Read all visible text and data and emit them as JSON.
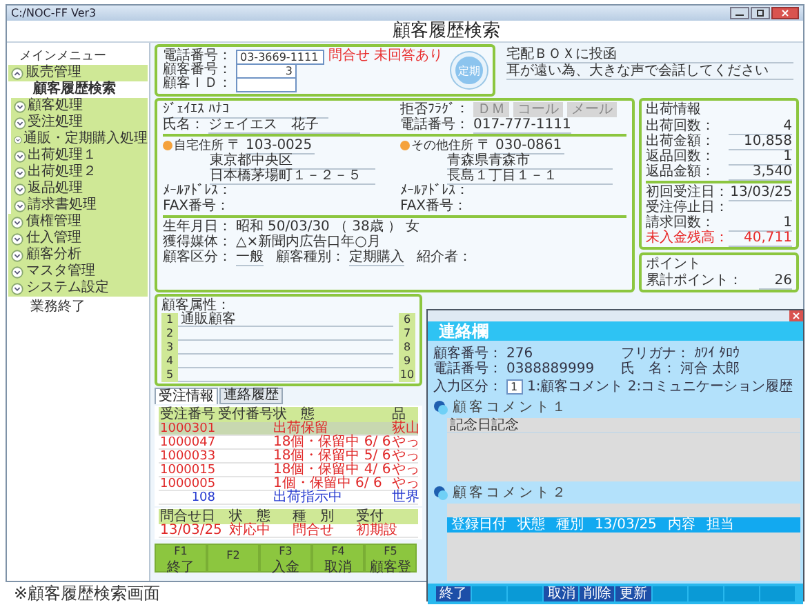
{
  "window": {
    "title": "C:/NOC-FF Ver3"
  },
  "header": {
    "title": "顧客履歴検索"
  },
  "sidebar": {
    "title": "メインメニュー",
    "groups": [
      {
        "label": "販売管理",
        "expanded": true,
        "children": [
          {
            "label": "顧客履歴検索",
            "kind": "page",
            "selected": true
          },
          {
            "label": "顧客処理",
            "kind": "folder",
            "selected": false
          },
          {
            "label": "受注処理",
            "kind": "folder",
            "selected": false
          },
          {
            "label": "通販・定期購入処理",
            "kind": "folder",
            "selected": false
          },
          {
            "label": "出荷処理１",
            "kind": "folder",
            "selected": false
          },
          {
            "label": "出荷処理２",
            "kind": "folder",
            "selected": false
          },
          {
            "label": "返品処理",
            "kind": "folder",
            "selected": false
          },
          {
            "label": "請求書処理",
            "kind": "folder",
            "selected": false
          }
        ]
      },
      {
        "label": "債権管理",
        "expanded": false
      },
      {
        "label": "仕入管理",
        "expanded": false
      },
      {
        "label": "顧客分析",
        "expanded": false
      },
      {
        "label": "マスタ管理",
        "expanded": false
      },
      {
        "label": "システム設定",
        "expanded": false
      }
    ],
    "footer": "業務終了"
  },
  "search": {
    "fields": [
      {
        "label": "電話番号：",
        "value": "03-3669-1111"
      },
      {
        "label": "顧客番号：",
        "value": "3"
      },
      {
        "label": "顧客ＩＤ："
      }
    ],
    "alerts": [
      "問合せ",
      "未回答あり"
    ],
    "refresh": "定期"
  },
  "notes": [
    "宅配ＢＯＸに投函",
    "耳が遠い為、大きな声で会話してください"
  ],
  "customer": {
    "kana": "ｼﾞｪｲｴｽ ﾊﾅｺ",
    "name_label": "氏名：",
    "name": "ジェイエス　花子",
    "refusal": {
      "label": "拒否ﾌﾗｸﾞ：",
      "options": [
        {
          "label": "ＤＭ",
          "on": false
        },
        {
          "label": "コール",
          "on": false
        },
        {
          "label": "メール",
          "on": false
        }
      ]
    },
    "phone_label": "電話番号：",
    "phone": "017-777-1111",
    "addresses": [
      {
        "label": "自宅住所",
        "zip_mark": "〒",
        "zip": "103-0025",
        "lines": [
          "東京都中央区",
          "日本橋茅場町１－２－５"
        ],
        "contacts": [
          {
            "label": "ﾒｰﾙｱﾄﾞﾚｽ："
          },
          {
            "label": "FAX番号："
          }
        ]
      },
      {
        "label": "その他住所",
        "zip_mark": "〒",
        "zip": "030-0861",
        "lines": [
          "青森県青森市",
          "長島１丁目１－１"
        ],
        "contacts": [
          {
            "label": "ﾒｰﾙｱﾄﾞﾚｽ："
          },
          {
            "label": "FAX番号："
          }
        ]
      }
    ],
    "birth": {
      "label": "生年月日：",
      "era": "昭和",
      "date": "50/03/30",
      "age": "（ 38歳 ）",
      "sex": "女"
    },
    "media": {
      "label": "獲得媒体：",
      "value": "△×新聞内広告口年○月"
    },
    "class_fields": [
      {
        "label": "顧客区分：",
        "value": "一般"
      },
      {
        "label": "顧客種別：",
        "value": "定期購入"
      },
      {
        "label": "紹介者："
      }
    ]
  },
  "shipping": {
    "title": "出荷情報",
    "groups": [
      [
        {
          "label": "出荷回数：",
          "value": "4",
          "alert": false
        },
        {
          "label": "出荷金額：",
          "value": "10,858",
          "alert": false
        },
        {
          "label": "返品回数：",
          "value": "1",
          "alert": false
        },
        {
          "label": "返品金額：",
          "value": "3,540",
          "alert": false
        }
      ],
      [
        {
          "label": "初回受注日：",
          "value": "13/03/25",
          "alert": false
        },
        {
          "label": "受注停止日：",
          "alert": false
        },
        {
          "label": "請求回数：",
          "value": "1",
          "alert": false
        },
        {
          "label": "未入金残高：",
          "value": "40,711",
          "alert": true
        }
      ]
    ]
  },
  "points": {
    "title": "ポイント",
    "rows": [
      {
        "label": "累計ポイント：",
        "value": "26"
      }
    ]
  },
  "attributes": {
    "label": "顧客属性：",
    "rows": [
      {
        "no": "1",
        "value": "通販顧客"
      },
      {
        "no": "2"
      },
      {
        "no": "3"
      },
      {
        "no": "4"
      },
      {
        "no": "5"
      }
    ],
    "rows_right": [
      {
        "no": "6"
      },
      {
        "no": "7"
      },
      {
        "no": "8"
      },
      {
        "no": "9"
      },
      {
        "no": "10"
      }
    ]
  },
  "tabs": [
    {
      "label": "受注情報",
      "selected": true
    },
    {
      "label": "連絡履歴",
      "selected": false
    }
  ],
  "orders": {
    "columns": [
      "受注番号",
      "受付番号",
      "状　態",
      "品"
    ],
    "rows": [
      {
        "order_no": "1000301",
        "status": "出荷保留",
        "item": "荻山",
        "color": "#e02828",
        "selected": true
      },
      {
        "order_no": "1000047",
        "status": "18個・保留中 6/ 6",
        "item": "やっ",
        "color": "#e02828",
        "selected": false
      },
      {
        "order_no": "1000033",
        "status": "18個・保留中 5/ 6",
        "item": "やっ",
        "color": "#e02828",
        "selected": false
      },
      {
        "order_no": "1000015",
        "status": "18個・保留中 4/ 6",
        "item": "やっ",
        "color": "#e02828",
        "selected": false
      },
      {
        "order_no": "1000005",
        "status": "1個・保留中 6/ 6",
        "item": "やっ",
        "color": "#e02828",
        "selected": false
      },
      {
        "order_no": "108",
        "status": "出荷指示中",
        "item": "世界",
        "color": "#2438d0",
        "selected": false
      }
    ]
  },
  "inquiries": {
    "columns": [
      "問合せ日",
      "状　態",
      "種　別",
      "受付"
    ],
    "rows": [
      {
        "cells": [
          "13/03/25",
          "対応中",
          "問合せ",
          "初期設"
        ],
        "color": "#e02828"
      }
    ]
  },
  "function_keys": [
    {
      "key": "F1",
      "label": "終了"
    },
    {
      "key": "F2"
    },
    {
      "key": "F3",
      "label": "入金"
    },
    {
      "key": "F4",
      "label": "取消"
    },
    {
      "key": "F5",
      "label": "顧客登"
    }
  ],
  "dialog": {
    "header": "連絡欄",
    "fields": [
      {
        "label": "顧客番号：",
        "value": "276"
      },
      {
        "label": "フリガナ：",
        "value": "ｶﾜｲ ﾀﾛｳ"
      },
      {
        "label": "電話番号：",
        "value": "0388889999"
      },
      {
        "label": "氏　名：",
        "value": "河合 太郎"
      }
    ],
    "input_type": {
      "label": "入力区分：",
      "value": "1",
      "hint": "1:顧客コメント 2:コミュニケーション履歴"
    },
    "comments": [
      {
        "title": "顧客コメント１",
        "lines": [
          "記念日記念"
        ]
      },
      {
        "title": "顧客コメント２",
        "band": [
          "登録日付",
          "状態",
          "種別",
          "13/03/25",
          "内容",
          "担当"
        ]
      }
    ],
    "buttons": [
      {
        "kind": "key",
        "label": "終了"
      },
      {
        "kind": "blank"
      },
      {
        "kind": "blank"
      },
      {
        "kind": "key",
        "label": "取消"
      },
      {
        "kind": "key",
        "label": "削除"
      },
      {
        "kind": "key",
        "label": "更新"
      },
      {
        "kind": "blank"
      },
      {
        "kind": "blank"
      },
      {
        "kind": "blank"
      },
      {
        "kind": "blank"
      }
    ]
  },
  "caption": "※顧客履歴検索画面"
}
